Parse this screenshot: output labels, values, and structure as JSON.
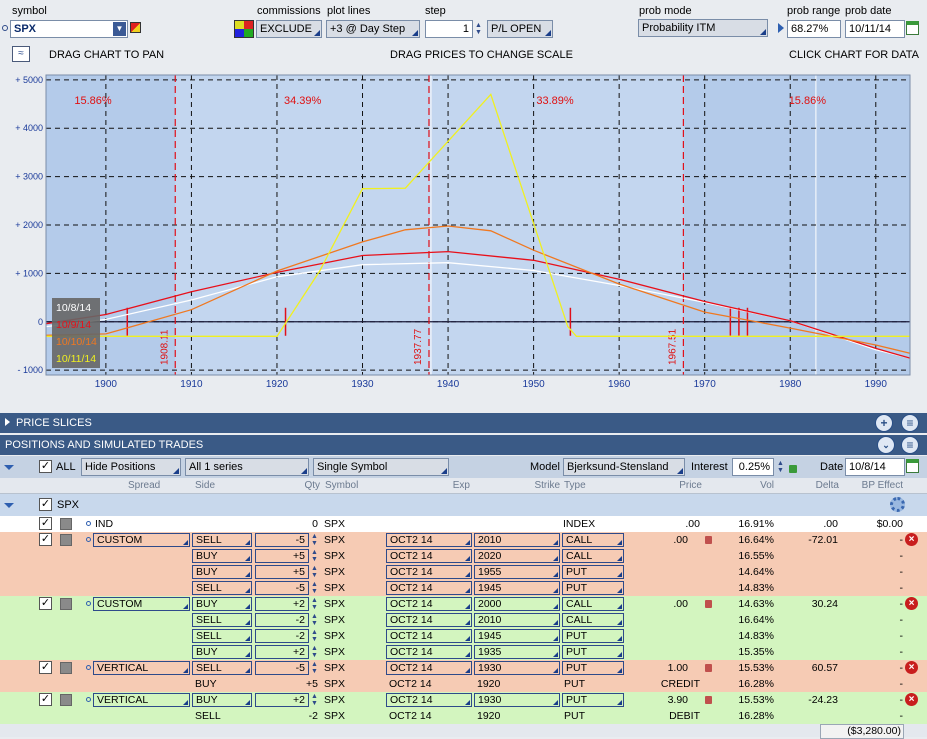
{
  "toolbar": {
    "symbol_label": "symbol",
    "symbol_value": "SPX",
    "commissions_label": "commissions",
    "commissions_value": "EXCLUDE",
    "plot_lines_label": "plot lines",
    "plot_lines_value": "+3 @ Day Step",
    "step_label": "step",
    "step_value": "1",
    "pl_mode": "P/L OPEN",
    "prob_mode_label": "prob mode",
    "prob_mode_value": "Probability ITM",
    "prob_range_label": "prob range",
    "prob_range_value": "68.27%",
    "prob_date_label": "prob date",
    "prob_date_value": "10/11/14"
  },
  "chart_header": {
    "left": "DRAG CHART TO PAN",
    "center": "DRAG PRICES TO CHANGE SCALE",
    "right": "CLICK CHART FOR DATA"
  },
  "chart_data": {
    "type": "line",
    "x_ticks": [
      "1900",
      "1910",
      "1920",
      "1930",
      "1940",
      "1950",
      "1960",
      "1970",
      "1980",
      "1990"
    ],
    "y_ticks": [
      "+ 5000",
      "+ 4000",
      "+ 3000",
      "+ 2000",
      "+ 1000",
      "0",
      "- 1000"
    ],
    "xlim": [
      1893,
      1994
    ],
    "ylim": [
      -1100,
      5100
    ],
    "prob_labels": [
      {
        "x": 1898.5,
        "text": "15.86%"
      },
      {
        "x": 1923,
        "text": "34.39%"
      },
      {
        "x": 1952.5,
        "text": "33.89%"
      },
      {
        "x": 1982,
        "text": "15.86%"
      }
    ],
    "range_lines": [
      {
        "x": 1908.11,
        "label": "1908.11"
      },
      {
        "x": 1937.77,
        "label": "1937.77"
      },
      {
        "x": 1967.51,
        "label": "1967.51"
      }
    ],
    "vgrid": [
      1893,
      1938,
      1983
    ],
    "series": [
      {
        "name": "10/8/14",
        "color": "#ffffff",
        "x": [
          1893,
          1900,
          1910,
          1920,
          1930,
          1940,
          1950,
          1960,
          1970,
          1980,
          1990,
          1994
        ],
        "y": [
          -100,
          50,
          450,
          930,
          1180,
          1220,
          1060,
          750,
          400,
          20,
          -580,
          -750
        ]
      },
      {
        "name": "10/9/14",
        "color": "#e8101a",
        "x": [
          1893,
          1900,
          1910,
          1920,
          1930,
          1940,
          1950,
          1960,
          1970,
          1980,
          1990,
          1994
        ],
        "y": [
          -40,
          150,
          620,
          1020,
          1370,
          1450,
          1270,
          880,
          420,
          20,
          -550,
          -750
        ]
      },
      {
        "name": "10/10/14",
        "color": "#f07820",
        "x": [
          1893,
          1900,
          1910,
          1920,
          1930,
          1935,
          1940,
          1945,
          1950,
          1960,
          1970,
          1980,
          1990,
          1994
        ],
        "y": [
          -280,
          -250,
          250,
          1050,
          1650,
          1900,
          1980,
          1880,
          1480,
          780,
          200,
          -130,
          -480,
          -650
        ]
      },
      {
        "name": "10/11/14",
        "color": "#f0f020",
        "x": [
          1893,
          1920,
          1925,
          1930,
          1935,
          1945,
          1954,
          1955,
          1994
        ],
        "y": [
          -300,
          -300,
          1050,
          2750,
          2760,
          4700,
          -100,
          -300,
          -300
        ]
      }
    ]
  },
  "sections": {
    "price_slices": "PRICE SLICES",
    "positions": "POSITIONS AND SIMULATED TRADES"
  },
  "positions_toolbar": {
    "all_label": "ALL",
    "hide_positions": "Hide Positions",
    "series": "All 1 series",
    "symbol_mode": "Single Symbol",
    "model_label": "Model",
    "model_value": "Bjerksund-Stensland",
    "interest_label": "Interest",
    "interest_value": "0.25%",
    "date_label": "Date",
    "date_value": "10/8/14"
  },
  "columns": [
    "Spread",
    "Side",
    "Qty",
    "Symbol",
    "Exp",
    "Strike",
    "Type",
    "Price",
    "Vol",
    "Delta",
    "BP Effect"
  ],
  "group": {
    "name": "SPX"
  },
  "index_row": {
    "spread": "IND",
    "qty": "0",
    "symbol": "SPX",
    "type": "INDEX",
    "price": ".00",
    "vol": "16.91%",
    "delta": ".00",
    "bp": "$0.00"
  },
  "legs": [
    {
      "spread": "CUSTOM",
      "side": "SELL",
      "qty": "-5",
      "symbol": "SPX",
      "exp": "OCT2 14",
      "strike": "2010",
      "type": "CALL",
      "price": ".00",
      "vol": "16.64%",
      "delta": "-72.01",
      "bp": "-"
    },
    {
      "spread": "",
      "side": "BUY",
      "qty": "+5",
      "symbol": "SPX",
      "exp": "OCT2 14",
      "strike": "2020",
      "type": "CALL",
      "price": "",
      "vol": "16.55%",
      "delta": "",
      "bp": "-"
    },
    {
      "spread": "",
      "side": "BUY",
      "qty": "+5",
      "symbol": "SPX",
      "exp": "OCT2 14",
      "strike": "1955",
      "type": "PUT",
      "price": "",
      "vol": "14.64%",
      "delta": "",
      "bp": "-"
    },
    {
      "spread": "",
      "side": "SELL",
      "qty": "-5",
      "symbol": "SPX",
      "exp": "OCT2 14",
      "strike": "1945",
      "type": "PUT",
      "price": "",
      "vol": "14.83%",
      "delta": "",
      "bp": "-"
    },
    {
      "spread": "CUSTOM",
      "side": "BUY",
      "qty": "+2",
      "symbol": "SPX",
      "exp": "OCT2 14",
      "strike": "2000",
      "type": "CALL",
      "price": ".00",
      "vol": "14.63%",
      "delta": "30.24",
      "bp": "-"
    },
    {
      "spread": "",
      "side": "SELL",
      "qty": "-2",
      "symbol": "SPX",
      "exp": "OCT2 14",
      "strike": "2010",
      "type": "CALL",
      "price": "",
      "vol": "16.64%",
      "delta": "",
      "bp": "-"
    },
    {
      "spread": "",
      "side": "SELL",
      "qty": "-2",
      "symbol": "SPX",
      "exp": "OCT2 14",
      "strike": "1945",
      "type": "PUT",
      "price": "",
      "vol": "14.83%",
      "delta": "",
      "bp": "-"
    },
    {
      "spread": "",
      "side": "BUY",
      "qty": "+2",
      "symbol": "SPX",
      "exp": "OCT2 14",
      "strike": "1935",
      "type": "PUT",
      "price": "",
      "vol": "15.35%",
      "delta": "",
      "bp": "-"
    },
    {
      "spread": "VERTICAL",
      "side": "SELL",
      "qty": "-5",
      "symbol": "SPX",
      "exp": "OCT2 14",
      "strike": "1930",
      "type": "PUT",
      "price": "1.00",
      "vol": "15.53%",
      "delta": "60.57",
      "bp": "-"
    },
    {
      "spread": "",
      "side": "BUY",
      "qty": "+5",
      "symbol": "SPX",
      "exp": "OCT2 14",
      "strike": "1920",
      "type": "PUT",
      "price": "CREDIT",
      "vol": "16.28%",
      "delta": "",
      "bp": "-"
    },
    {
      "spread": "VERTICAL",
      "side": "BUY",
      "qty": "+2",
      "symbol": "SPX",
      "exp": "OCT2 14",
      "strike": "1930",
      "type": "PUT",
      "price": "3.90",
      "vol": "15.53%",
      "delta": "-24.23",
      "bp": "-"
    },
    {
      "spread": "",
      "side": "SELL",
      "qty": "-2",
      "symbol": "SPX",
      "exp": "OCT2 14",
      "strike": "1920",
      "type": "PUT",
      "price": "DEBIT",
      "vol": "16.28%",
      "delta": "",
      "bp": "-"
    }
  ],
  "total_bp": "($3,280.00)",
  "colors": {
    "sell_row": "#f6cbb4",
    "buy_row": "#d3f5bf",
    "chart_bg": "#c3d6ef",
    "section_bar": "#3a5a86"
  }
}
